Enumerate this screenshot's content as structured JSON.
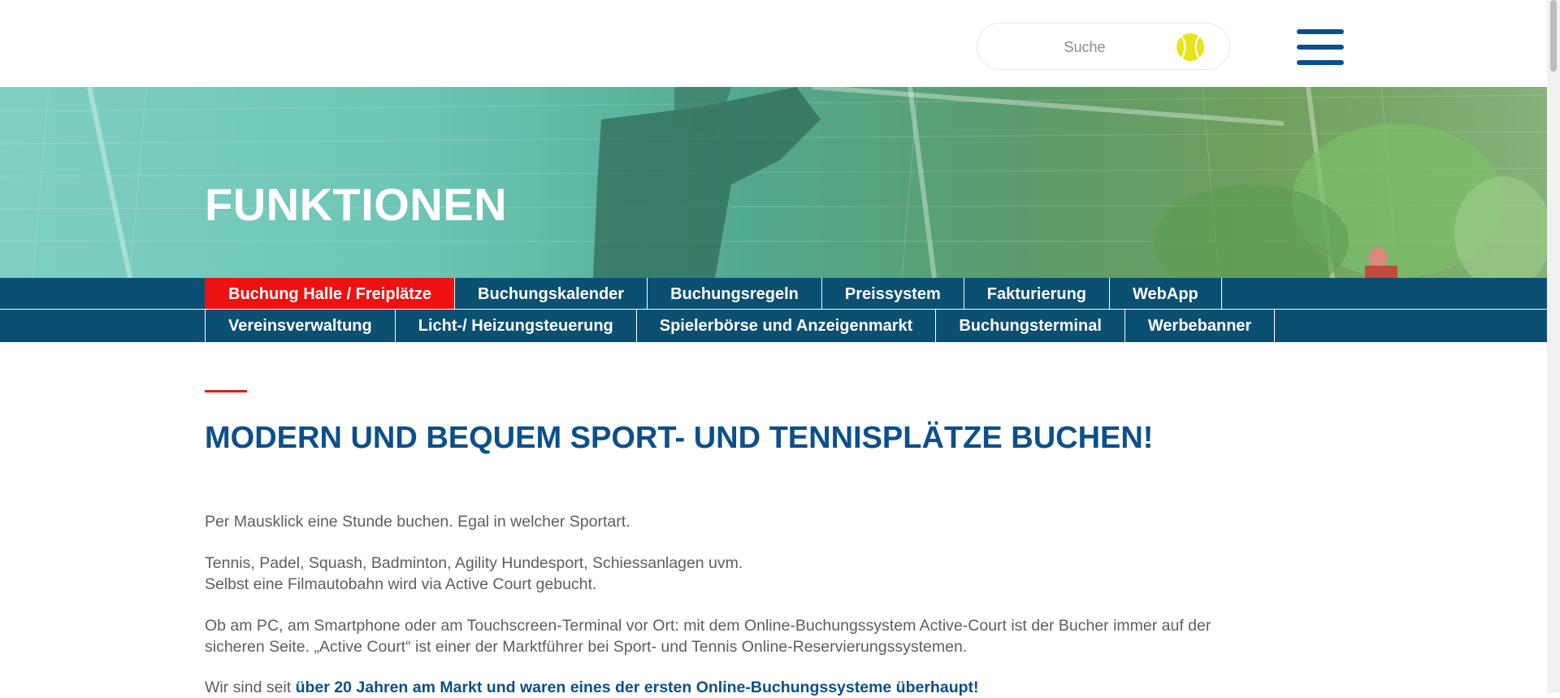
{
  "search": {
    "placeholder": "Suche"
  },
  "colors": {
    "brand_blue": "#0c4f8c",
    "nav_background": "#0b4f73",
    "accent_red": "#ee1111",
    "ball_yellow": "#e6e41a"
  },
  "icons": {
    "search_button": "tennis-ball-icon",
    "menu": "hamburger-menu-icon"
  },
  "hero": {
    "title": "FUNKTIONEN"
  },
  "nav": {
    "row1": [
      {
        "label": "Buchung Halle / Freiplätze",
        "active": true
      },
      {
        "label": "Buchungskalender"
      },
      {
        "label": "Buchungsregeln"
      },
      {
        "label": "Preissystem"
      },
      {
        "label": "Fakturierung"
      },
      {
        "label": "WebApp"
      }
    ],
    "row2": [
      {
        "label": "Vereinsverwaltung"
      },
      {
        "label": "Licht-/ Heizungsteuerung"
      },
      {
        "label": "Spielerbörse und Anzeigenmarkt"
      },
      {
        "label": "Buchungsterminal"
      },
      {
        "label": "Werbebanner"
      }
    ]
  },
  "main": {
    "title": "MODERN UND BEQUEM SPORT- UND TENNISPLÄTZE BUCHEN!",
    "p1": "Per Mausklick eine Stunde buchen. Egal in welcher Sportart.",
    "p2_line1": "Tennis, Padel, Squash, Badminton, Agility Hundesport, Schiessanlagen uvm.",
    "p2_line2": "Selbst eine Filmautobahn wird via Active Court gebucht.",
    "p3_line1": "Ob am PC, am Smartphone oder am Touchscreen-Terminal vor Ort: mit dem Online-Buchungssystem Active-Court ist der Bucher immer auf der",
    "p3_line2": "sicheren Seite. „Active Court“ ist einer der Marktführer bei Sport- und Tennis Online-Reservierungssystemen.",
    "p4_prefix": "Wir sind seit ",
    "p4_bold": "über 20 Jahren am Markt und waren eines der ersten Online-Buchungssysteme überhaupt!"
  }
}
